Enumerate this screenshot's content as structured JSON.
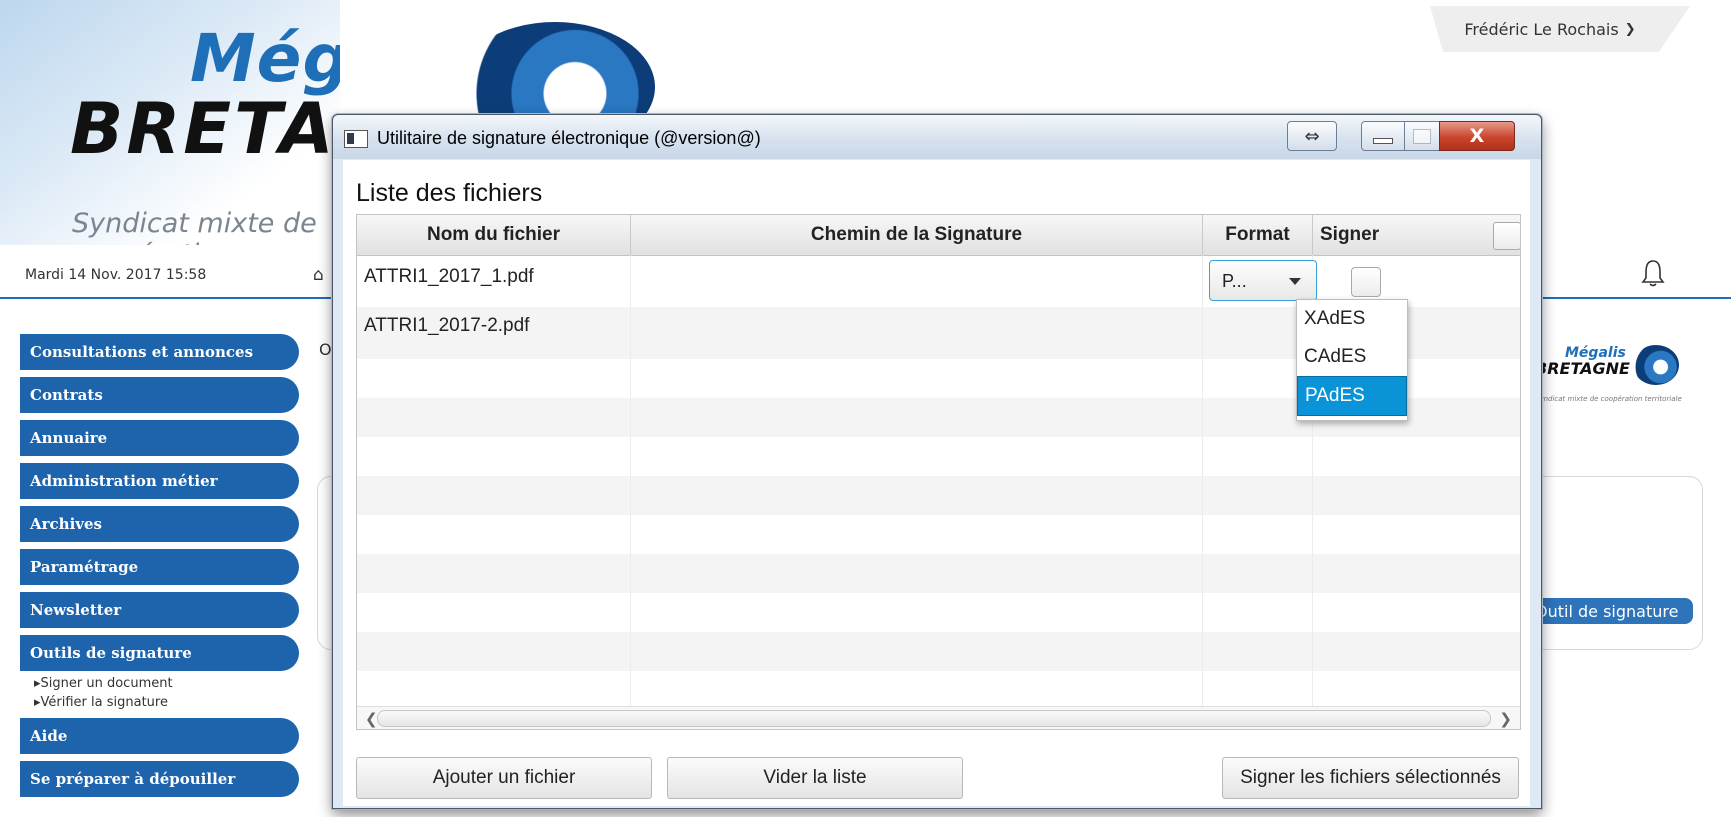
{
  "site": {
    "logo_line1": "Mégalis",
    "logo_line2": "BRETAGNE",
    "logo_tagline": "Syndicat mixte de coopération territoriale",
    "user_name": "Frédéric Le Rochais",
    "date_time": "Mardi 14 Nov. 2017 15:58",
    "partial_letter": "O",
    "tool_button": "Outil de signature",
    "right_logo_line1": "Mégalis",
    "right_logo_line2": "BRETAGNE",
    "right_logo_tagline": "Syndicat mixte de coopération territoriale",
    "accent_color": "#1e64ad"
  },
  "menu": {
    "items": [
      "Consultations et annonces",
      "Contrats",
      "Annuaire",
      "Administration métier",
      "Archives",
      "Paramétrage",
      "Newsletter",
      "Outils de signature",
      "Aide",
      "Se préparer à dépouiller"
    ],
    "submenu": [
      "Signer un document",
      "Vérifier la signature"
    ]
  },
  "dialog": {
    "title": "Utilitaire de signature électronique (@version@)",
    "list_title": "Liste des fichiers",
    "columns": [
      "Nom du fichier",
      "Chemin de la Signature",
      "Format",
      "Signer"
    ],
    "rows": [
      {
        "file": "ATTRI1_2017_1.pdf",
        "path": "",
        "format": "P...",
        "checked": false
      },
      {
        "file": "ATTRI1_2017-2.pdf",
        "path": "",
        "format": "",
        "checked": false
      }
    ],
    "format_options": [
      "XAdES",
      "CAdES",
      "PAdES"
    ],
    "selected_format": "PAdES",
    "buttons": {
      "add": "Ajouter un fichier",
      "clear": "Vider la liste",
      "sign": "Signer les fichiers sélectionnés"
    },
    "close_glyph": "X",
    "resize_glyph": "⇔"
  }
}
